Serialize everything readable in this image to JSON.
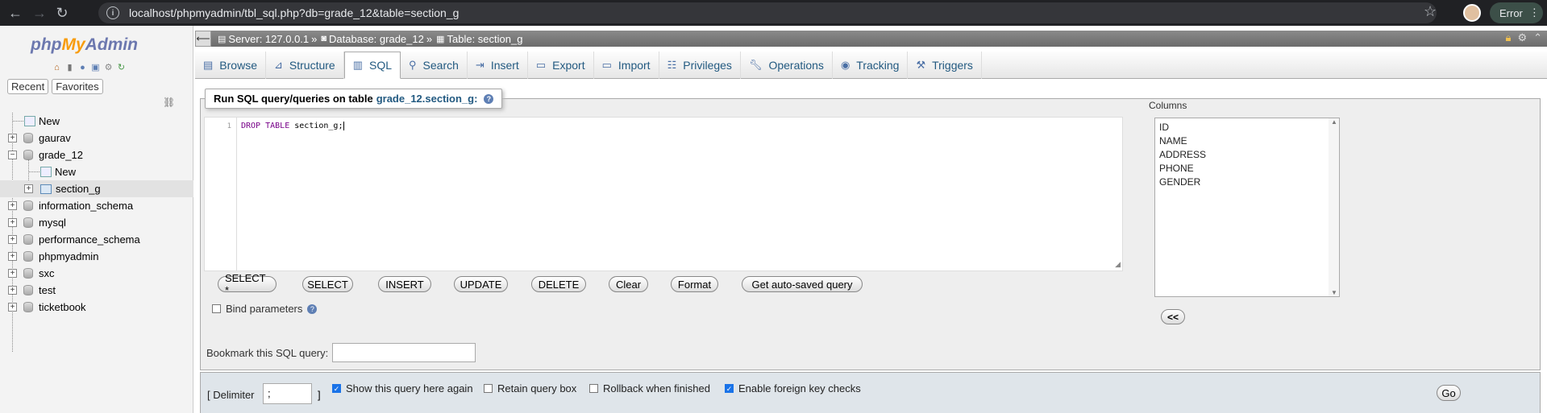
{
  "browser": {
    "url": "localhost/phpmyadmin/tbl_sql.php?db=grade_12&table=section_g",
    "error_label": "Error"
  },
  "sidebar": {
    "logo_php": "php",
    "logo_my": "My",
    "logo_admin": "Admin",
    "recent": "Recent",
    "favorites": "Favorites",
    "tree": [
      {
        "label": "New"
      },
      {
        "label": "gaurav"
      },
      {
        "label": "grade_12"
      },
      {
        "label": "New"
      },
      {
        "label": "section_g"
      },
      {
        "label": "information_schema"
      },
      {
        "label": "mysql"
      },
      {
        "label": "performance_schema"
      },
      {
        "label": "phpmyadmin"
      },
      {
        "label": "sxc"
      },
      {
        "label": "test"
      },
      {
        "label": "ticketbook"
      }
    ]
  },
  "breadcrumb": {
    "server": "Server: 127.0.0.1",
    "database": "Database: grade_12",
    "table": "Table: section_g",
    "sep": "»"
  },
  "tabs": [
    "Browse",
    "Structure",
    "SQL",
    "Search",
    "Insert",
    "Export",
    "Import",
    "Privileges",
    "Operations",
    "Tracking",
    "Triggers"
  ],
  "query": {
    "legend_prefix": "Run SQL query/queries on table",
    "legend_table": "grade_12.section_g:",
    "line_number": "1",
    "code_kw1": "DROP",
    "code_kw2": "TABLE",
    "code_rest": "section_g;",
    "buttons": [
      "SELECT *",
      "SELECT",
      "INSERT",
      "UPDATE",
      "DELETE",
      "Clear",
      "Format",
      "Get auto-saved query"
    ],
    "bind_parameters": "Bind parameters",
    "columns_label": "Columns",
    "columns": [
      "ID",
      "NAME",
      "ADDRESS",
      "PHONE",
      "GENDER"
    ],
    "insert_col_btn": "<<",
    "bookmark_label": "Bookmark this SQL query:"
  },
  "bottom": {
    "delimiter_label": "[ Delimiter",
    "delimiter_value": ";",
    "delimiter_close": "]",
    "show_query": "Show this query here again",
    "retain_box": "Retain query box",
    "rollback": "Rollback when finished",
    "foreign_keys": "Enable foreign key checks",
    "go": "Go"
  }
}
